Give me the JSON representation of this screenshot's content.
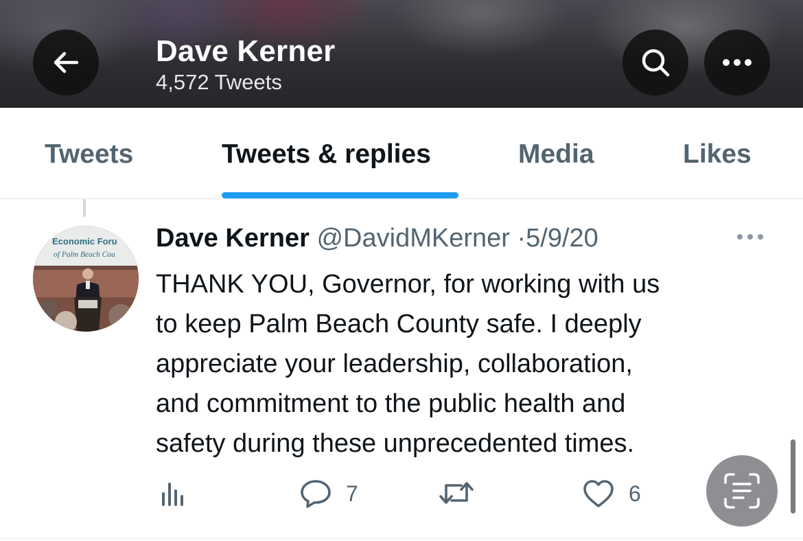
{
  "header": {
    "title": "Dave Kerner",
    "tweet_count": "4,572 Tweets",
    "back_icon": "arrow-left-icon",
    "search_icon": "search-icon",
    "more_icon": "more-horizontal-icon"
  },
  "tabs": [
    {
      "label": "Tweets",
      "active": false
    },
    {
      "label": "Tweets & replies",
      "active": true
    },
    {
      "label": "Media",
      "active": false
    },
    {
      "label": "Likes",
      "active": false
    }
  ],
  "tweet": {
    "author_name": "Dave Kerner",
    "handle": "@DavidMKerner",
    "separator": "·",
    "date": "5/9/20",
    "text": "THANK YOU, Governor, for working with us\nto keep Palm Beach County safe. I deeply\nappreciate your leadership, collaboration,\nand commitment to the public health and\nsafety during these unprecedented times.",
    "avatar_sign_line1": "Economic Foru",
    "avatar_sign_line2": "of Palm Beach Cou",
    "actions": {
      "replies": "7",
      "retweets": "",
      "likes": "6"
    }
  },
  "colors": {
    "accent": "#1d9bf0",
    "text_primary": "#0f1419",
    "text_secondary": "#536471",
    "scan_button": "#8e8e93"
  }
}
